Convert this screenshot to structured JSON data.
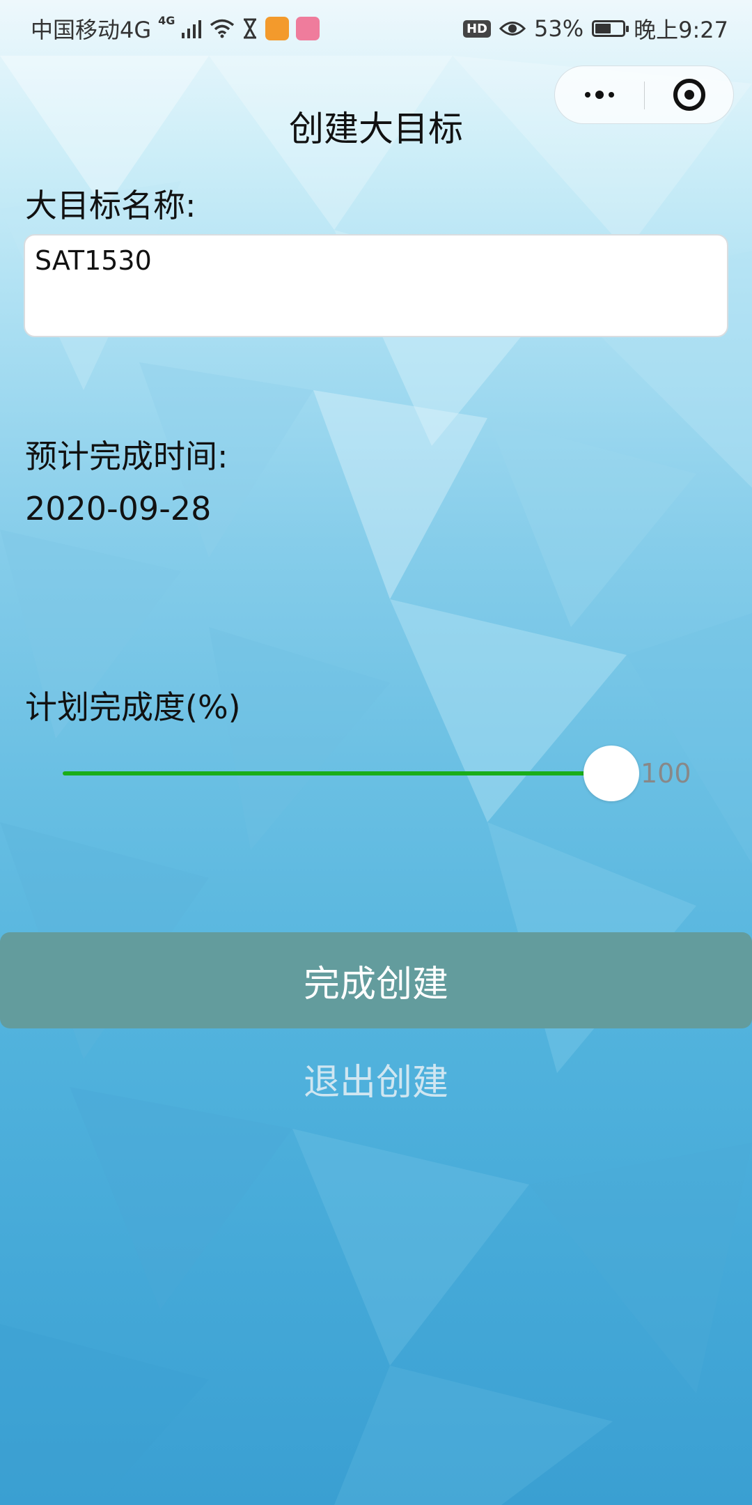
{
  "status_bar": {
    "carrier": "中国移动4G",
    "signal_sup": "4G",
    "hd_badge": "HD",
    "battery": "53%",
    "time": "晚上9:27"
  },
  "icons": {
    "signal": "signal-bars-icon",
    "wifi": "wifi-icon",
    "hourglass": "hourglass-icon",
    "uc_browser": "uc-browser-app-icon",
    "app2": "app-notification-icon",
    "eye": "eye-icon",
    "battery": "battery-icon",
    "more": "more-dots-icon",
    "close": "target-close-icon"
  },
  "page": {
    "title": "创建大目标"
  },
  "form": {
    "name_label": "大目标名称:",
    "name_value": "SAT1530",
    "date_label": "预计完成时间:",
    "date_value": "2020-09-28",
    "progress_label": "计划完成度(%)",
    "progress_value": "100",
    "progress_fraction": 1.0
  },
  "buttons": {
    "confirm": "完成创建",
    "cancel": "退出创建"
  },
  "colors": {
    "slider_active": "#1aad19",
    "primary_button": "#639c9d"
  }
}
